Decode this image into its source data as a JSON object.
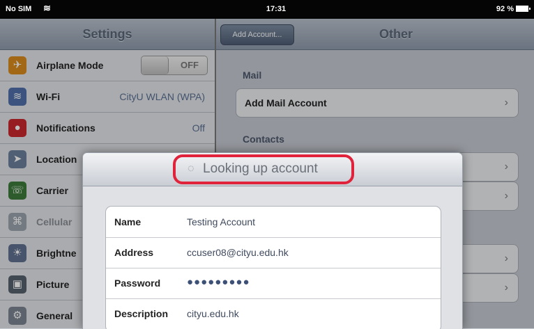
{
  "status_bar": {
    "carrier": "No SIM",
    "time": "17:31",
    "battery": "92 %"
  },
  "settings": {
    "title": "Settings",
    "items": [
      {
        "label": "Airplane Mode",
        "icon": "airplane-icon",
        "toggle": "OFF"
      },
      {
        "label": "Wi-Fi",
        "icon": "wifi-icon",
        "value": "CityU WLAN (WPA)"
      },
      {
        "label": "Notifications",
        "icon": "notifications-icon",
        "value": "Off"
      },
      {
        "label": "Location",
        "icon": "location-icon"
      },
      {
        "label": "Carrier",
        "icon": "carrier-icon"
      },
      {
        "label": "Cellular",
        "icon": "cellular-icon"
      },
      {
        "label": "Brightne",
        "icon": "brightness-icon"
      },
      {
        "label": "Picture",
        "icon": "picture-frame-icon"
      },
      {
        "label": "General",
        "icon": "gear-icon"
      }
    ]
  },
  "other": {
    "back_label": "Add Account...",
    "title": "Other",
    "mail_section": "Mail",
    "add_mail": "Add Mail Account",
    "contacts_section": "Contacts"
  },
  "dialog": {
    "status": "Looking up account",
    "fields": [
      {
        "key": "Name",
        "value": "Testing Account"
      },
      {
        "key": "Address",
        "value": "ccuser08@cityu.edu.hk"
      },
      {
        "key": "Password",
        "value": "●●●●●●●●●"
      },
      {
        "key": "Description",
        "value": "cityu.edu.hk"
      }
    ]
  }
}
